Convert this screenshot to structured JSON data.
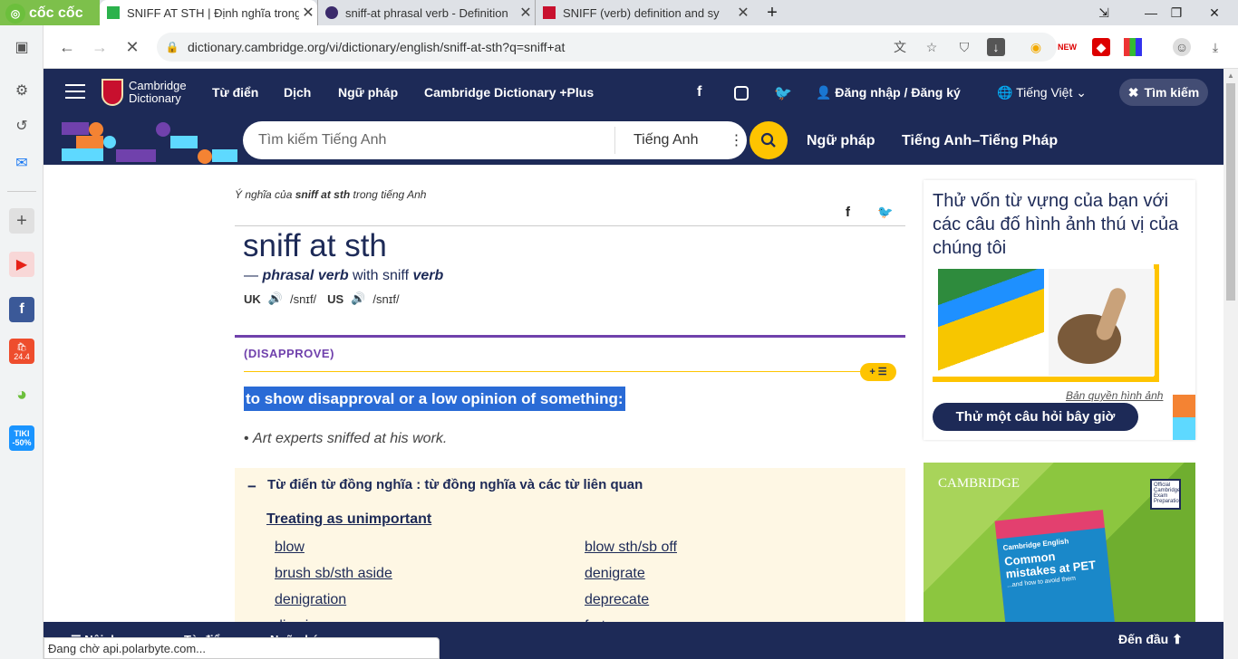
{
  "browser": {
    "brand": "cốc cốc",
    "tabs": [
      {
        "title": "SNIFF AT STH | Định nghĩa trong",
        "active": true
      },
      {
        "title": "sniff-at phrasal verb - Definition",
        "active": false
      },
      {
        "title": "SNIFF (verb) definition and sy",
        "active": false
      }
    ],
    "new_tab": "+",
    "url": "dictionary.cambridge.org/vi/dictionary/english/sniff-at-sth?q=sniff+at",
    "status": "Đang chờ api.polarbyte.com..."
  },
  "header": {
    "logo_line1": "Cambridge",
    "logo_line2": "Dictionary",
    "nav": [
      "Từ điển",
      "Dịch",
      "Ngữ pháp",
      "Cambridge Dictionary +Plus"
    ],
    "social": [
      "f",
      "ig",
      "tw"
    ],
    "login": "Đăng nhập / Đăng ký",
    "language": "Tiếng Việt",
    "search_toggle": "Tìm kiếm"
  },
  "searchbar": {
    "placeholder": "Tìm kiếm Tiếng Anh",
    "dictionary": "Tiếng Anh",
    "links": [
      "Ngữ pháp",
      "Tiếng Anh–Tiếng Pháp"
    ]
  },
  "entry": {
    "meaning_prefix": "Ý nghĩa của ",
    "meaning_word": "sniff at sth",
    "meaning_suffix": " trong tiếng Anh",
    "headword": "sniff at sth",
    "dash": "— ",
    "pos": "phrasal verb",
    "with": " with sniff ",
    "pos2": "verb",
    "uk_label": "UK",
    "uk_ipa": "/snɪf/",
    "us_label": "US",
    "us_ipa": "/snɪf/",
    "guideword": "(DISAPPROVE)",
    "definition": "to show disapproval or a low opinion of something:",
    "example": "Art experts sniffed at his work.",
    "add_list": "+ ☰"
  },
  "thesaurus": {
    "title": "Từ điển từ đồng nghĩa : từ đồng nghĩa và các từ liên quan",
    "heading": "Treating as unimportant",
    "left": [
      "blow",
      "brush sb/sth aside",
      "denigration",
      "dismiss"
    ],
    "right": [
      "blow sth/sb off",
      "denigrate",
      "deprecate",
      "fart"
    ]
  },
  "quiz": {
    "text": "Thử vốn từ vựng của bạn với các câu đố hình ảnh thú vị của chúng tôi",
    "credit": "Bản quyền hình ảnh",
    "button": "Thử một câu hỏi bây giờ"
  },
  "ad": {
    "brand": "CAMBRIDGE",
    "book_series": "Cambridge English",
    "book_title": "Common mistakes at PET",
    "book_sub": "...and how to avoid them",
    "badge": "Official Cambridge Exam Preparation"
  },
  "bottom": {
    "left": [
      "Nội dung",
      "Từ điển",
      "Ngữ pháp"
    ],
    "top_link": "Đến đầu"
  },
  "sidebar": {
    "items": [
      "bookmark",
      "settings",
      "history",
      "messenger",
      "add",
      "youtube",
      "facebook",
      "shopee",
      "cashback",
      "tiki"
    ],
    "shopee_badge": "24.4",
    "tiki_badge": "TIKI -50%"
  },
  "colors": {
    "brand_navy": "#1d2a57",
    "accent_yellow": "#fec400",
    "guideword_purple": "#7041ac",
    "thesaurus_bg": "#fef7e4"
  }
}
